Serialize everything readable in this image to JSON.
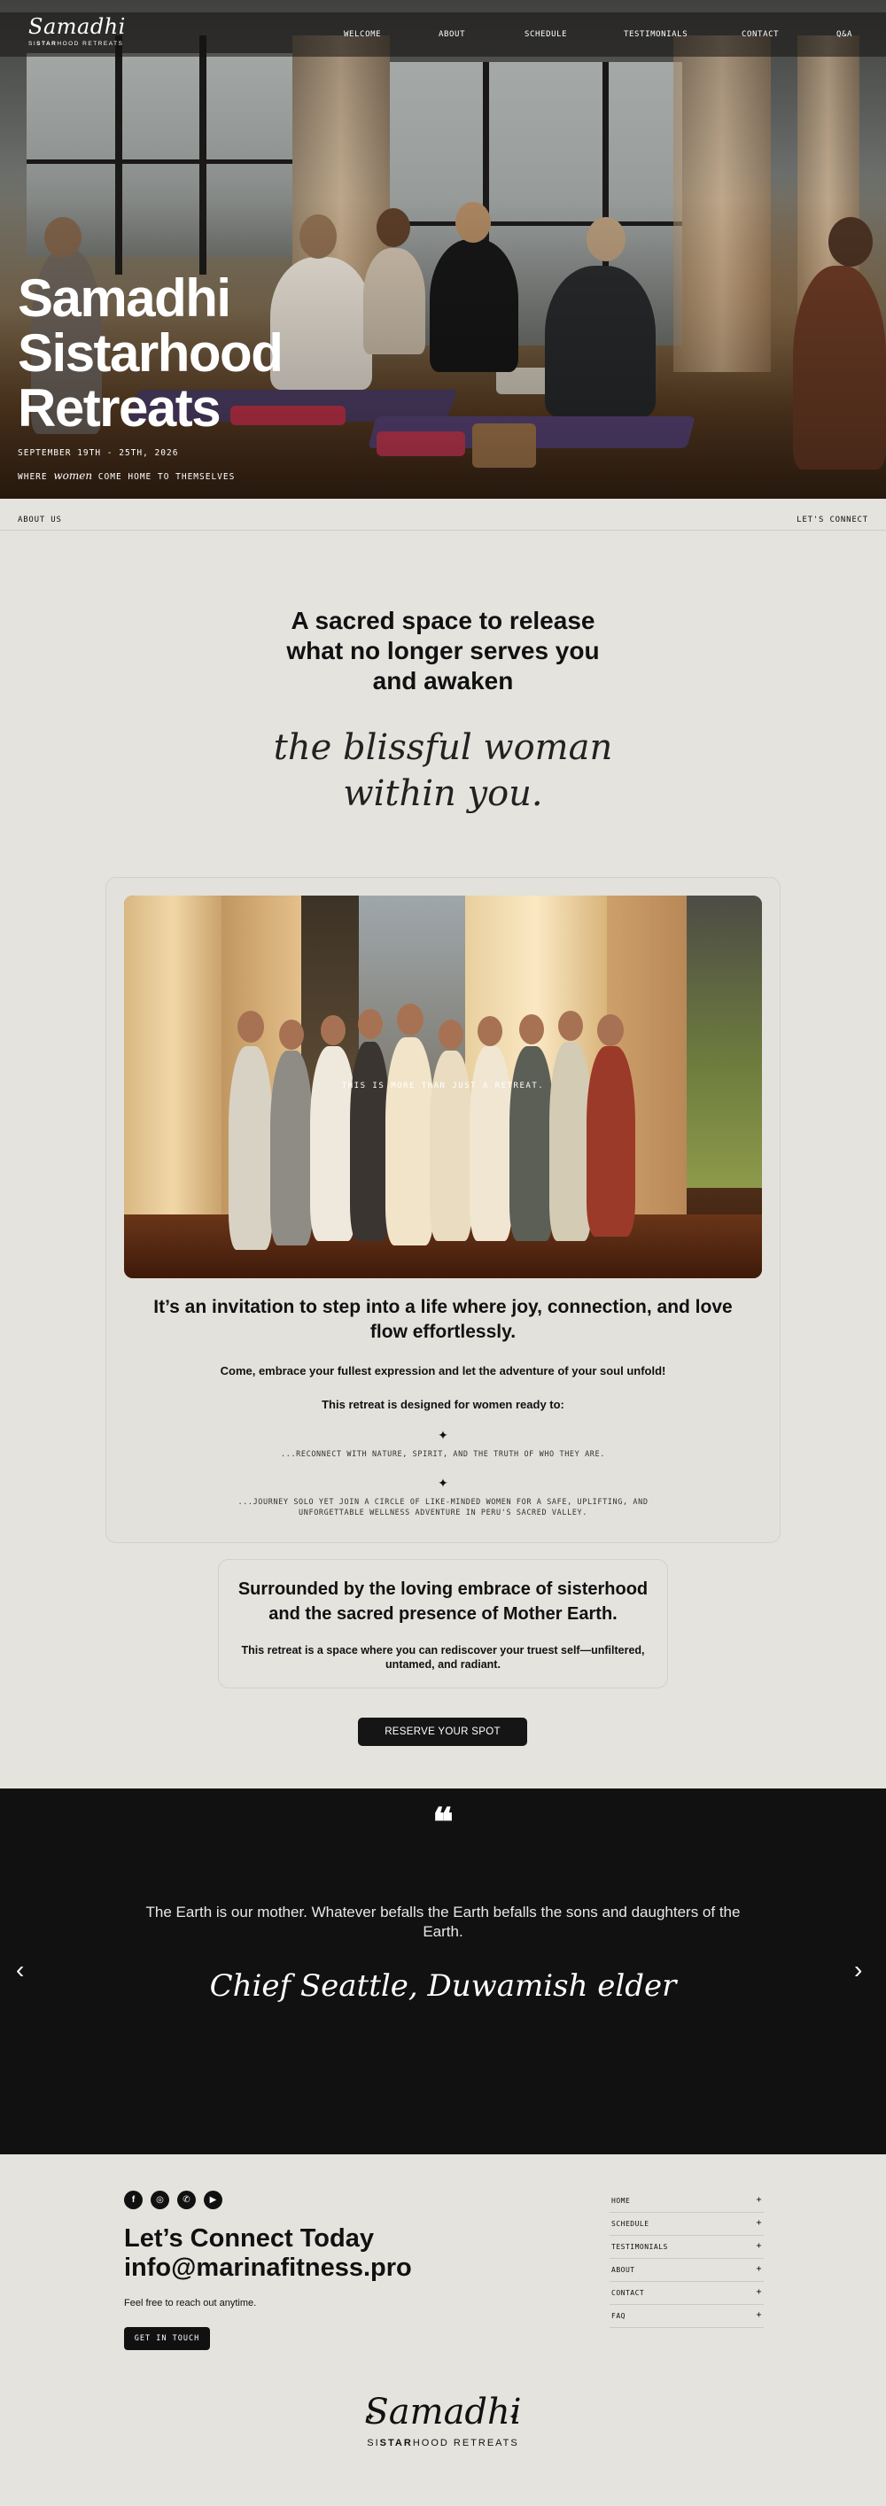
{
  "brand": {
    "logo_script": "Samadhi",
    "logo_sub_pre": "SI",
    "logo_sub_bold": "STAR",
    "logo_sub_post": "HOOD RETREATS"
  },
  "nav": {
    "items": [
      "WELCOME",
      "ABOUT",
      "SCHEDULE",
      "TESTIMONIALS",
      "CONTACT",
      "Q&A"
    ]
  },
  "hero": {
    "title": "Samadhi Sistarhood Retreats",
    "date": "SEPTEMBER 19TH - 25TH, 2026",
    "tagline_pre": "WHERE",
    "tagline_script": "women",
    "tagline_post": "COME HOME TO THEMSELVES"
  },
  "subnav": {
    "left": "ABOUT US",
    "right": "LET'S CONNECT"
  },
  "intro": {
    "heading": "A sacred space to release what no longer serves you and awaken",
    "script": "the blissful woman within you."
  },
  "card": {
    "photo_caption": "THIS IS MORE THAN JUST A RETREAT.",
    "invite_heading": "It’s an invitation to step into a life where joy, connection, and love flow effortlessly.",
    "embrace": "Come, embrace your fullest expression and let the adventure of your soul unfold!",
    "designed_for": "This retreat is designed for women ready to:",
    "star_glyph": "✦",
    "points": [
      "...RECONNECT WITH NATURE, SPIRIT, AND THE TRUTH OF WHO THEY ARE.",
      "...JOURNEY SOLO YET JOIN A CIRCLE OF LIKE-MINDED WOMEN FOR A SAFE, UPLIFTING, AND UNFORGETTABLE WELLNESS ADVENTURE IN PERU'S SACRED VALLEY."
    ]
  },
  "sisterhood": {
    "heading": "Surrounded by the loving embrace of sisterhood and the sacred presence of Mother Earth.",
    "body": "This retreat is a space where you can rediscover your truest self—unfiltered, untamed, and radiant."
  },
  "cta": {
    "reserve_label": "RESERVE YOUR SPOT"
  },
  "testimonial": {
    "quote_icon": "quote-icon",
    "quote_glyph": "❝",
    "text": "The Earth is our mother. Whatever befalls the Earth befalls the sons and daughters of the Earth.",
    "author": "Chief Seattle, Duwamish elder",
    "prev_glyph": "‹",
    "next_glyph": "›"
  },
  "footer": {
    "socials": [
      {
        "icon": "facebook-icon",
        "glyph": "f"
      },
      {
        "icon": "instagram-icon",
        "glyph": "◎"
      },
      {
        "icon": "whatsapp-icon",
        "glyph": "✆"
      },
      {
        "icon": "youtube-icon",
        "glyph": "▶"
      }
    ],
    "heading": "Let’s Connect Today",
    "email": "info@marinafitness.pro",
    "reach": "Feel free to reach out anytime.",
    "button": "GET IN TOUCH",
    "links": [
      "HOME",
      "SCHEDULE",
      "TESTIMONIALS",
      "ABOUT",
      "CONTACT",
      "FAQ"
    ],
    "plus_glyph": "+"
  },
  "colors": {
    "background": "#e4e3dd",
    "dark": "#111111",
    "button": "#151515"
  }
}
